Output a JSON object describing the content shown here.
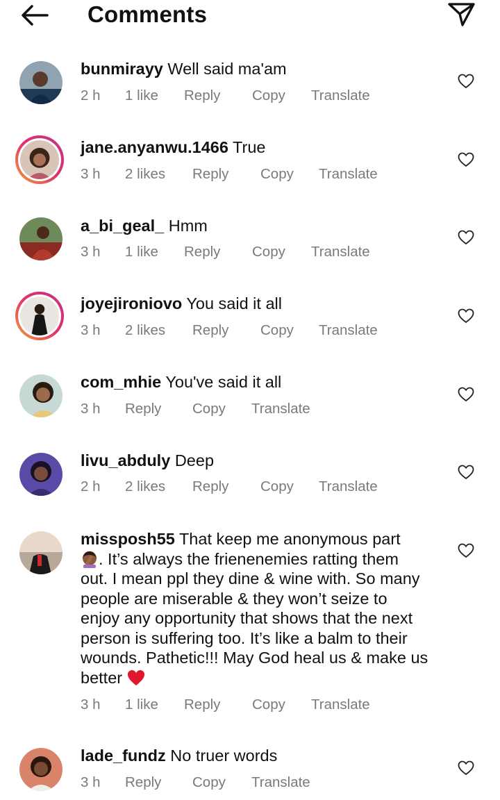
{
  "header": {
    "title": "Comments",
    "back_icon": "arrow-left-icon",
    "send_icon": "paper-plane-icon"
  },
  "comments": [
    {
      "username": "bunmirayy",
      "text": "Well said ma'am",
      "time": "2 h",
      "likes": "1 like",
      "reply": "Reply",
      "copy": "Copy",
      "translate": "Translate"
    },
    {
      "username": "jane.anyanwu.1466",
      "text": "True",
      "time": "3 h",
      "likes": "2 likes",
      "reply": "Reply",
      "copy": "Copy",
      "translate": "Translate"
    },
    {
      "username": "a_bi_geal_",
      "text": "Hmm",
      "time": "3 h",
      "likes": "1 like",
      "reply": "Reply",
      "copy": "Copy",
      "translate": "Translate"
    },
    {
      "username": "joyejironiovo",
      "text": "You said it all",
      "time": "3 h",
      "likes": "2 likes",
      "reply": "Reply",
      "copy": "Copy",
      "translate": "Translate"
    },
    {
      "username": "com_mhie",
      "text": "You've said it all",
      "time": "3 h",
      "reply": "Reply",
      "copy": "Copy",
      "translate": "Translate"
    },
    {
      "username": "livu_abduly",
      "text": "Deep",
      "time": "2 h",
      "likes": "2 likes",
      "reply": "Reply",
      "copy": "Copy",
      "translate": "Translate"
    },
    {
      "username": "missposh55",
      "text_lines": [
        "That keep me anonymous part",
        ". It’s always the frienenemies ratting them",
        "out. I mean ppl they dine & wine with. So many",
        "people are miserable & they won’t seize to",
        "enjoy any opportunity that shows that the next",
        "person is suffering too. It’s like a balm to their",
        "wounds. Pathetic!!! May God heal us & make us",
        "better"
      ],
      "time": "3 h",
      "likes": "1 like",
      "reply": "Reply",
      "copy": "Copy",
      "translate": "Translate"
    },
    {
      "username": "lade_fundz",
      "text": "No truer words",
      "time": "3 h",
      "reply": "Reply",
      "copy": "Copy",
      "translate": "Translate"
    }
  ],
  "icons": {
    "like": "heart-outline-icon",
    "facepalm": "woman-facepalming-emoji",
    "heart": "red-heart-emoji"
  },
  "colors": {
    "meta": "#7a7a7a",
    "story_ring_start": "#f2a23a",
    "story_ring_end": "#c13584",
    "heart_emoji": "#e0182d"
  }
}
